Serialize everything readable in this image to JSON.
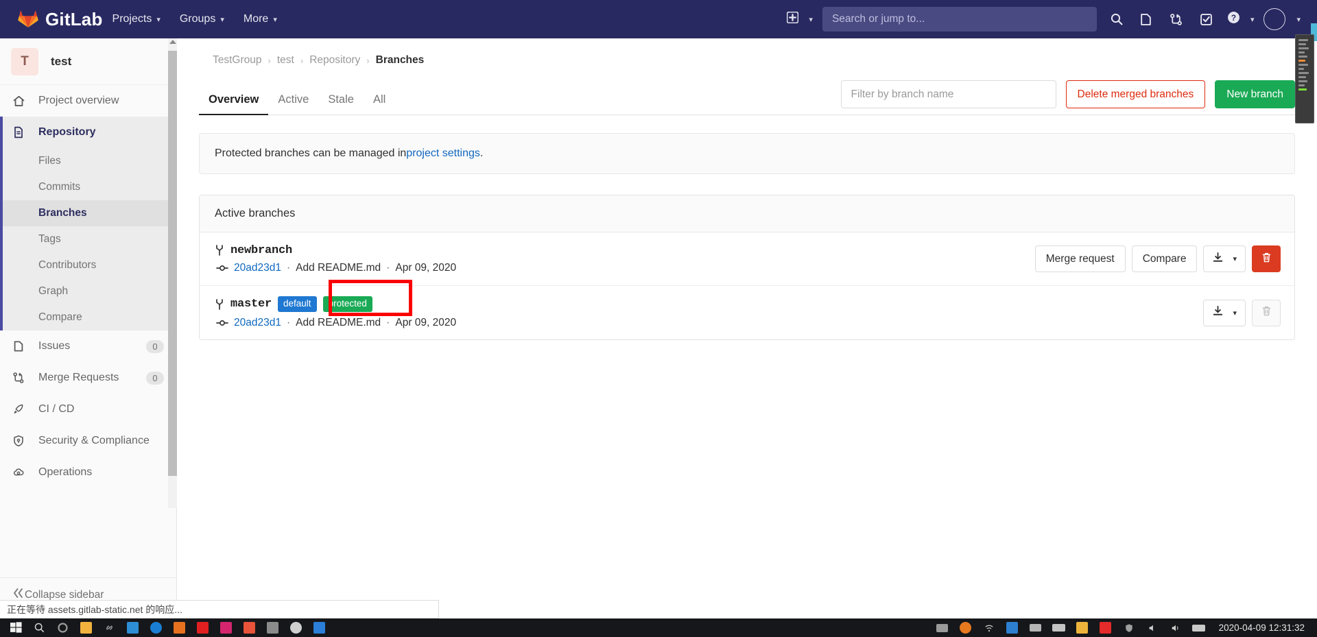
{
  "navbar": {
    "brand": "GitLab",
    "logo_icon": "gitlab-tanuki-icon",
    "links": [
      {
        "label": "Projects",
        "icon": "chevron-down-icon"
      },
      {
        "label": "Groups",
        "icon": "chevron-down-icon"
      },
      {
        "label": "More",
        "icon": "chevron-down-icon"
      }
    ],
    "plus_icon": "plus-square-icon",
    "plus_caret": "chevron-down-icon",
    "search": {
      "placeholder": "Search or jump to...",
      "value": "",
      "icon": "search-icon"
    },
    "icons": [
      {
        "name": "issues-icon"
      },
      {
        "name": "merge-request-icon"
      },
      {
        "name": "todos-icon"
      },
      {
        "name": "help-icon"
      },
      {
        "name": "user-avatar-icon"
      }
    ]
  },
  "sidebar": {
    "project": {
      "initial": "T",
      "name": "test"
    },
    "overview": {
      "label": "Project overview",
      "icon": "home-icon"
    },
    "repository": {
      "label": "Repository",
      "icon": "document-icon"
    },
    "repository_children": [
      {
        "label": "Files",
        "active": false
      },
      {
        "label": "Commits",
        "active": false
      },
      {
        "label": "Branches",
        "active": true
      },
      {
        "label": "Tags",
        "active": false
      },
      {
        "label": "Contributors",
        "active": false
      },
      {
        "label": "Graph",
        "active": false
      },
      {
        "label": "Compare",
        "active": false
      }
    ],
    "items": [
      {
        "label": "Issues",
        "icon": "issues-icon",
        "count": "0"
      },
      {
        "label": "Merge Requests",
        "icon": "merge-request-icon",
        "count": "0"
      },
      {
        "label": "CI / CD",
        "icon": "rocket-icon",
        "count": ""
      },
      {
        "label": "Security & Compliance",
        "icon": "shield-icon",
        "count": ""
      },
      {
        "label": "Operations",
        "icon": "cloud-gear-icon",
        "count": ""
      }
    ],
    "collapse": {
      "label": "Collapse sidebar",
      "icon": "collapse-icon"
    }
  },
  "breadcrumb": {
    "items": [
      "TestGroup",
      "test",
      "Repository"
    ],
    "current": "Branches",
    "separator": "›"
  },
  "tabs": [
    {
      "label": "Overview",
      "active": true
    },
    {
      "label": "Active",
      "active": false
    },
    {
      "label": "Stale",
      "active": false
    },
    {
      "label": "All",
      "active": false
    }
  ],
  "toolbar": {
    "filter_placeholder": "Filter by branch name",
    "filter_value": "",
    "delete_merged_label": "Delete merged branches",
    "new_branch_label": "New branch",
    "delete_merged_color": "#dd2b0e",
    "new_branch_color": "#1aaa55"
  },
  "notice": {
    "text_before": "Protected branches can be managed in ",
    "link": "project settings",
    "text_after": "."
  },
  "branches_card": {
    "title": "Active branches",
    "rows": [
      {
        "name": "newbranch",
        "icon": "branch-icon",
        "badges": [],
        "commit": {
          "icon": "commit-icon",
          "sha": "20ad23d1",
          "separator": "·",
          "message": "Add README.md",
          "date": "Apr 09, 2020"
        },
        "actions": {
          "merge_request": "Merge request",
          "compare": "Compare",
          "download_icon": "download-icon",
          "download_caret": "chevron-down-icon",
          "delete_icon": "trash-icon",
          "delete_enabled": true
        }
      },
      {
        "name": "master",
        "icon": "branch-icon",
        "badges": [
          {
            "label": "default",
            "color": "#1f78d1"
          },
          {
            "label": "protected",
            "color": "#1aaa55"
          }
        ],
        "commit": {
          "icon": "commit-icon",
          "sha": "20ad23d1",
          "separator": "·",
          "message": "Add README.md",
          "date": "Apr 09, 2020"
        },
        "actions": {
          "merge_request": "",
          "compare": "",
          "download_icon": "download-icon",
          "download_caret": "chevron-down-icon",
          "delete_icon": "trash-icon",
          "delete_enabled": false
        }
      }
    ]
  },
  "annotation": {
    "box_color": "#fb0000"
  },
  "statusbar": {
    "text": "正在等待 assets.gitlab-static.net 的响应..."
  },
  "taskbar": {
    "clock": "2020-04-09  12:31:32",
    "left_icons": [
      "start-icon",
      "search-icon",
      "cortana-icon",
      "folder-icon",
      "link-icon",
      "editor-icon",
      "browser-icon",
      "notes-icon",
      "video-icon",
      "shop-icon",
      "adobe-icon",
      "terminal-icon",
      "chrome-icon",
      "store-icon"
    ],
    "right_icons": [
      "monitor-icon",
      "firefox-icon",
      "network-icon",
      "bluetooth-icon",
      "window-icon",
      "keyboard-icon",
      "folder2-icon",
      "mail-icon",
      "shield-icon",
      "speaker-icon",
      "volume-icon",
      "battery-icon",
      "ime-icon"
    ]
  }
}
